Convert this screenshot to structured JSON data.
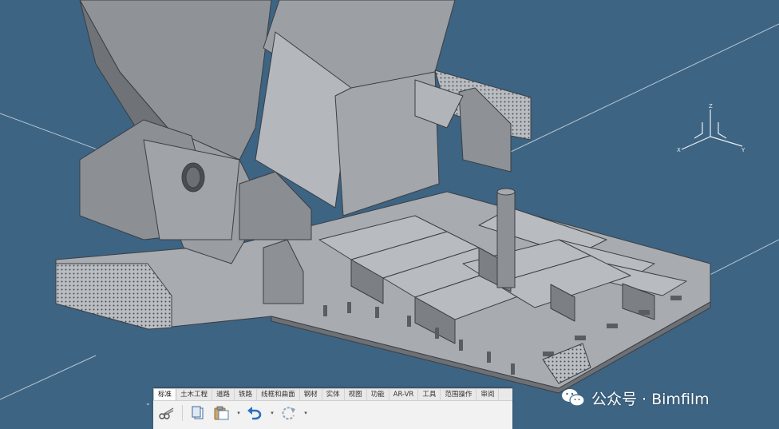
{
  "ribbon": {
    "tabs": [
      {
        "label": "标准",
        "active": true
      },
      {
        "label": "土木工程",
        "active": false
      },
      {
        "label": "道路",
        "active": false
      },
      {
        "label": "铁路",
        "active": false
      },
      {
        "label": "线框和曲面",
        "active": false
      },
      {
        "label": "钢材",
        "active": false
      },
      {
        "label": "实体",
        "active": false
      },
      {
        "label": "视图",
        "active": false
      },
      {
        "label": "功能",
        "active": false
      },
      {
        "label": "AR-VR",
        "active": false
      },
      {
        "label": "工具",
        "active": false
      },
      {
        "label": "范围操作",
        "active": false
      },
      {
        "label": "审阅",
        "active": false
      }
    ],
    "tools": [
      {
        "name": "cut-icon"
      },
      {
        "name": "copy-icon"
      },
      {
        "name": "paste-icon"
      },
      {
        "name": "undo-icon"
      },
      {
        "name": "redo-icon"
      }
    ]
  },
  "watermark": {
    "text": "公众号 · Bimfilm",
    "icon": "wechat-icon"
  },
  "gizmo": {
    "labels": {
      "z": "Z",
      "x": "X",
      "y": "Y"
    }
  },
  "colors": {
    "background": "#3d6483",
    "steel_light": "#a9adb2",
    "steel_mid": "#8e9297",
    "steel_dark": "#6d7176",
    "edge": "#3b3e42",
    "ribbon_bg": "#f2f2f2"
  }
}
